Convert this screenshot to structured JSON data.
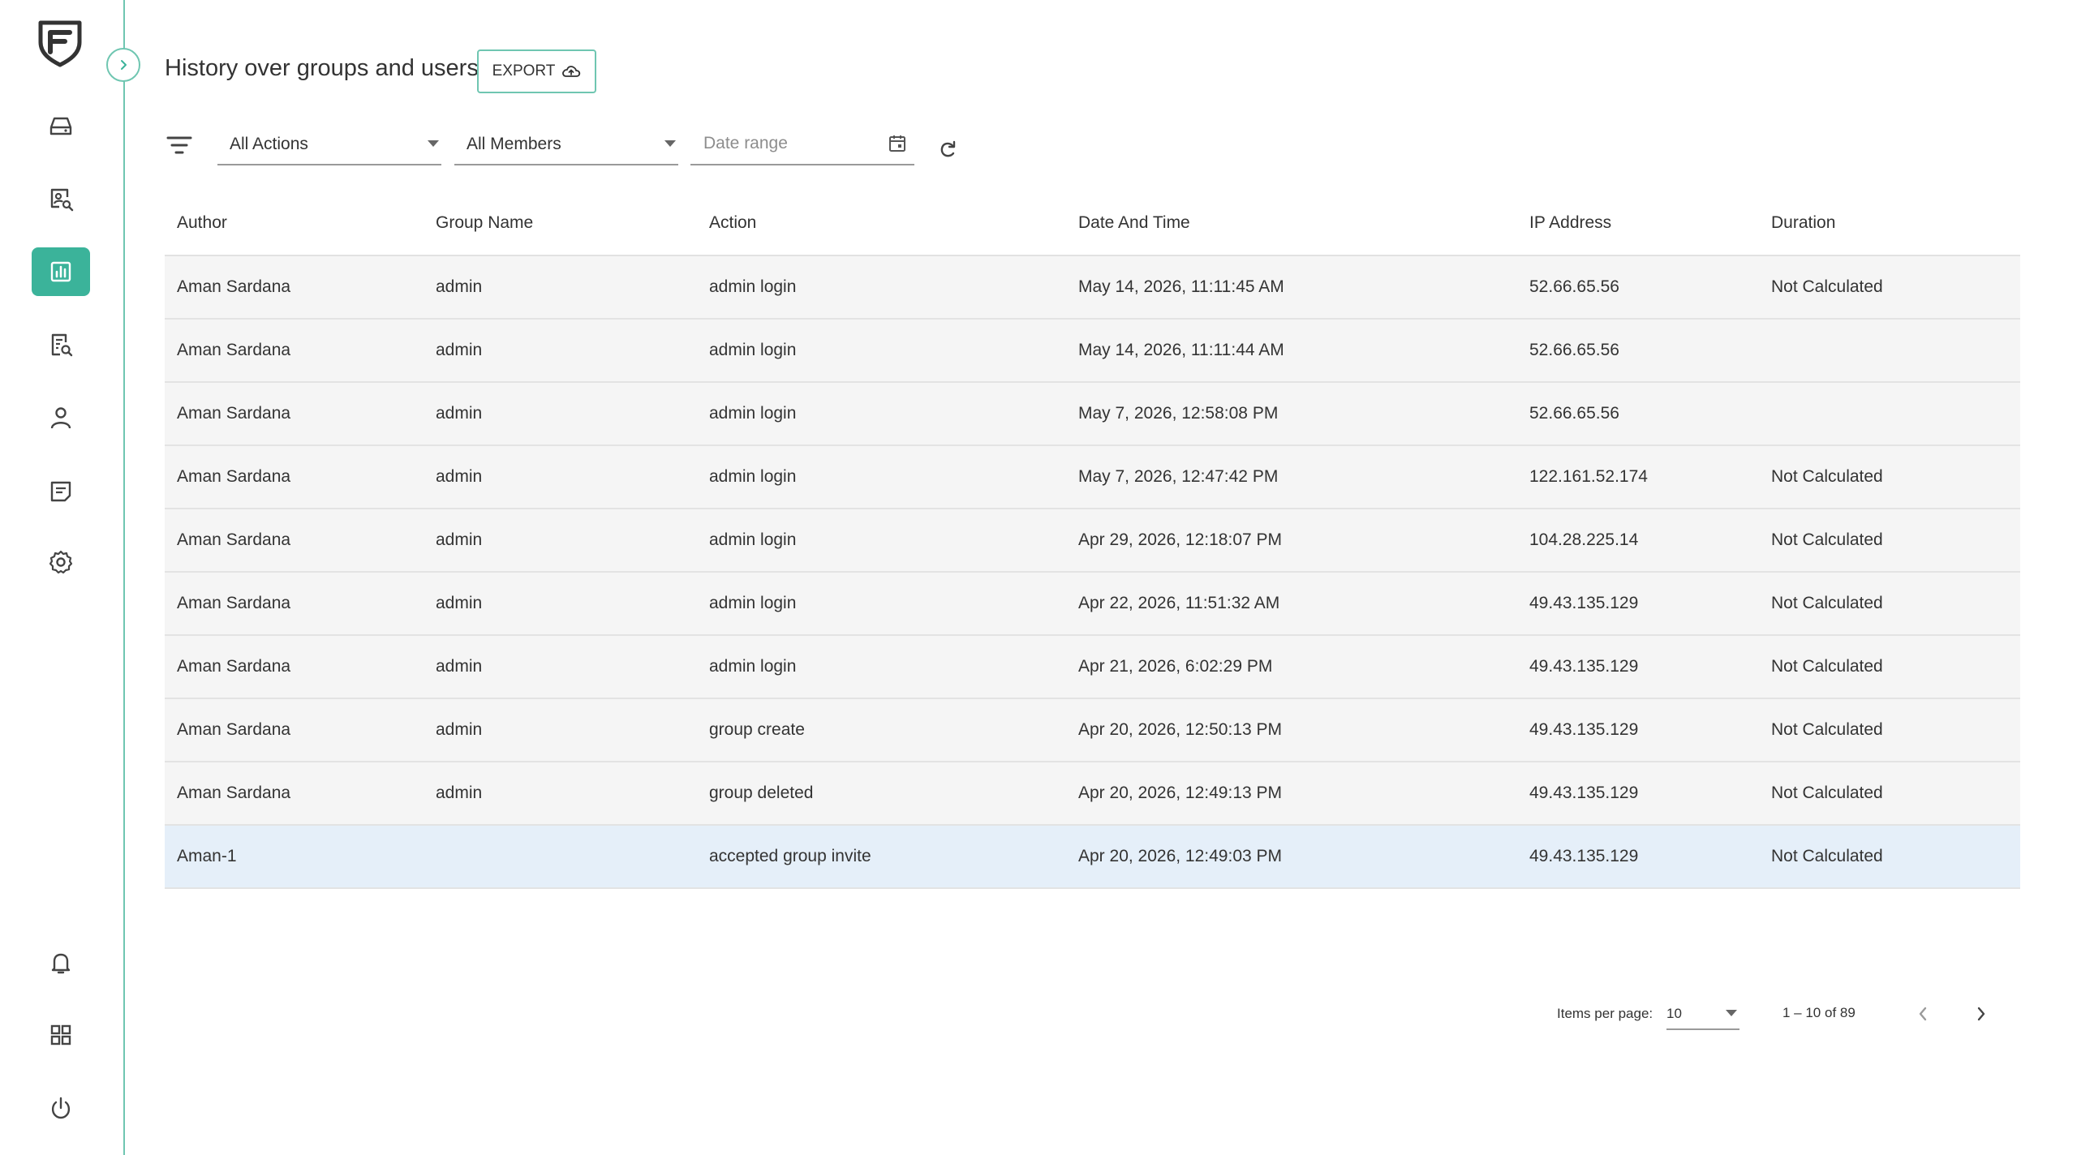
{
  "sidebar": {
    "items": [
      {
        "name": "storage",
        "icon": "drive-icon"
      },
      {
        "name": "user-search",
        "icon": "user-search-icon"
      },
      {
        "name": "reports",
        "icon": "chart-icon",
        "active": true
      },
      {
        "name": "audit",
        "icon": "document-search-icon"
      },
      {
        "name": "users",
        "icon": "person-icon"
      },
      {
        "name": "messages",
        "icon": "message-icon"
      },
      {
        "name": "settings",
        "icon": "gear-icon"
      }
    ],
    "bottom_items": [
      {
        "name": "notifications",
        "icon": "bell-icon"
      },
      {
        "name": "apps",
        "icon": "grid-icon"
      },
      {
        "name": "logout",
        "icon": "power-icon"
      }
    ],
    "accent": "#3bb39a"
  },
  "header": {
    "title": "History over groups and users",
    "export_label": "EXPORT"
  },
  "filters": {
    "actions_value": "All Actions",
    "members_value": "All Members",
    "date_placeholder": "Date range"
  },
  "table": {
    "columns": [
      "Author",
      "Group Name",
      "Action",
      "Date And Time",
      "IP Address",
      "Duration"
    ],
    "rows": [
      [
        "Aman Sardana",
        "admin",
        "admin login",
        "May 14, 2026, 11:11:45 AM",
        "52.66.65.56",
        "Not Calculated"
      ],
      [
        "Aman Sardana",
        "admin",
        "admin login",
        "May 14, 2026, 11:11:44 AM",
        "52.66.65.56",
        ""
      ],
      [
        "Aman Sardana",
        "admin",
        "admin login",
        "May 7, 2026, 12:58:08 PM",
        "52.66.65.56",
        ""
      ],
      [
        "Aman Sardana",
        "admin",
        "admin login",
        "May 7, 2026, 12:47:42 PM",
        "122.161.52.174",
        "Not Calculated"
      ],
      [
        "Aman Sardana",
        "admin",
        "admin login",
        "Apr 29, 2026, 12:18:07 PM",
        "104.28.225.14",
        "Not Calculated"
      ],
      [
        "Aman Sardana",
        "admin",
        "admin login",
        "Apr 22, 2026, 11:51:32 AM",
        "49.43.135.129",
        "Not Calculated"
      ],
      [
        "Aman Sardana",
        "admin",
        "admin login",
        "Apr 21, 2026, 6:02:29 PM",
        "49.43.135.129",
        "Not Calculated"
      ],
      [
        "Aman Sardana",
        "admin",
        "group create",
        "Apr 20, 2026, 12:50:13 PM",
        "49.43.135.129",
        "Not Calculated"
      ],
      [
        "Aman Sardana",
        "admin",
        "group deleted",
        "Apr 20, 2026, 12:49:13 PM",
        "49.43.135.129",
        "Not Calculated"
      ],
      [
        "Aman-1",
        "",
        "accepted group invite",
        "Apr 20, 2026, 12:49:03 PM",
        "49.43.135.129",
        "Not Calculated"
      ]
    ],
    "highlight_row": 9
  },
  "pagination": {
    "items_per_page_label": "Items per page:",
    "items_per_page_value": "10",
    "range_label": "1 – 10 of 89"
  }
}
